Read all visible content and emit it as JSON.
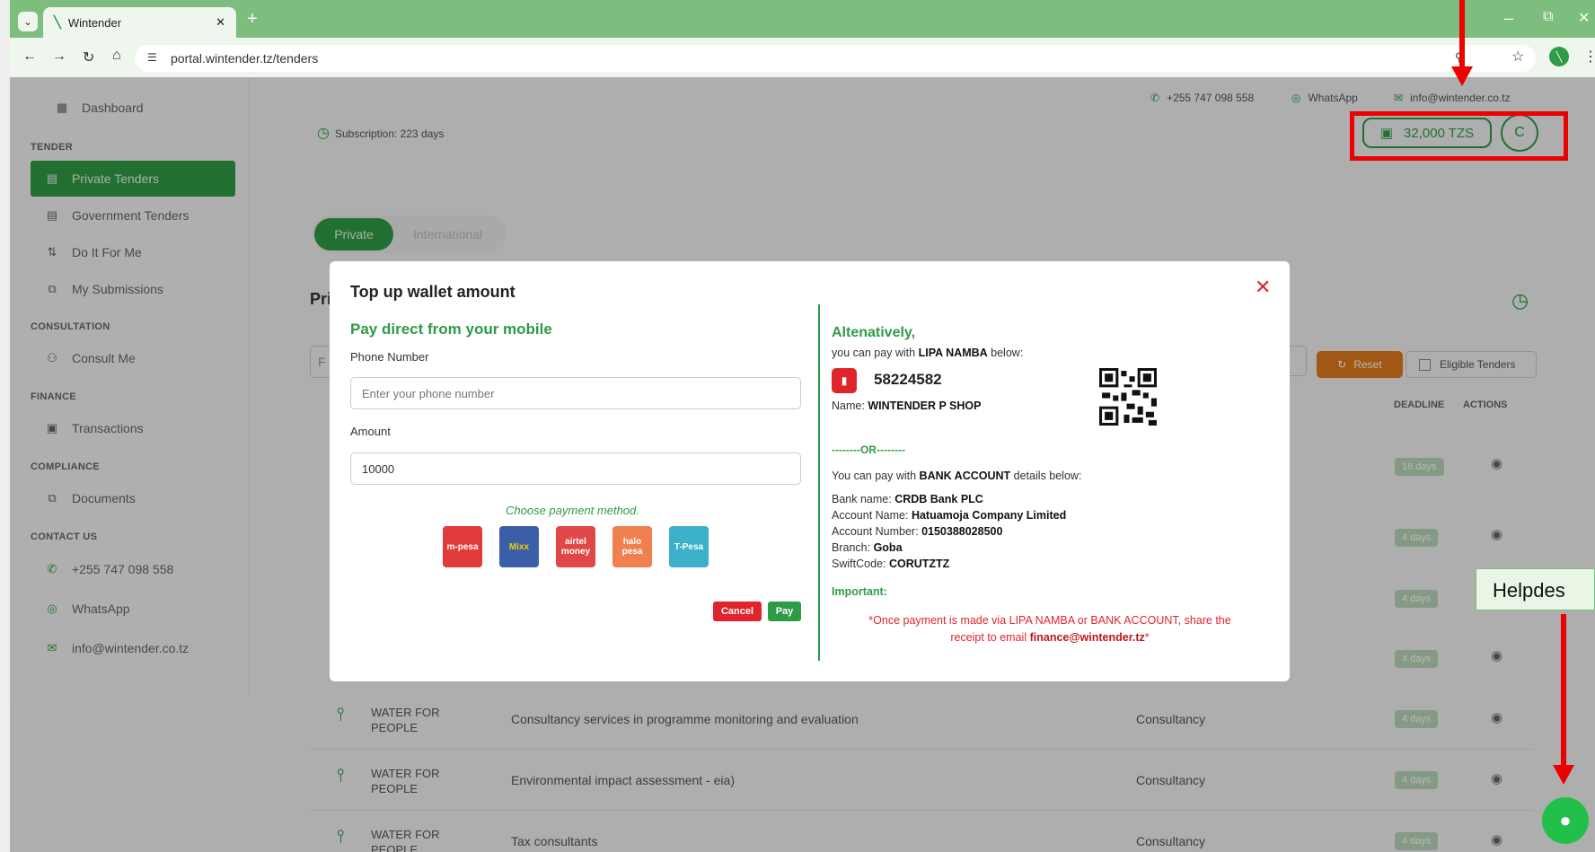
{
  "browser": {
    "tab_title": "Wintender",
    "url": "portal.wintender.tz/tenders"
  },
  "topbar": {
    "phone": "+255 747 098 558",
    "whatsapp": "WhatsApp",
    "email": "info@wintender.co.tz",
    "subscription": "Subscription: 223 days",
    "wallet": "32,000 TZS",
    "avatar": "C"
  },
  "sidebar": {
    "dashboard": "Dashboard",
    "sec_tender": "TENDER",
    "private": "Private Tenders",
    "government": "Government Tenders",
    "doit": "Do It For Me",
    "submissions": "My Submissions",
    "sec_consult": "CONSULTATION",
    "consult": "Consult Me",
    "sec_finance": "FINANCE",
    "transactions": "Transactions",
    "sec_compliance": "COMPLIANCE",
    "documents": "Documents",
    "sec_contact": "CONTACT US",
    "phone": "+255 747 098 558",
    "whatsapp": "WhatsApp",
    "email": "info@wintender.co.tz"
  },
  "main": {
    "tab_private": "Private",
    "tab_international": "International",
    "heading_fragment": "Pri",
    "filter_fragment": "F",
    "reset": "Reset",
    "eligible": "Eligible Tenders",
    "col_deadline": "DEADLINE",
    "col_actions": "ACTIONS",
    "rows": [
      {
        "org": "WATER FOR PEOPLE",
        "title": "Consultancy services in programme monitoring and evaluation",
        "category": "Consultancy",
        "deadline": "4 days"
      },
      {
        "org": "WATER FOR PEOPLE",
        "title": "Environmental impact assessment - eia)",
        "category": "Consultancy",
        "deadline": "4 days"
      },
      {
        "org": "WATER FOR PEOPLE",
        "title": "Tax consultants",
        "category": "Consultancy",
        "deadline": "4 days"
      }
    ],
    "hidden_deadlines": [
      "16 days",
      "4 days",
      "4 days",
      "4 days"
    ]
  },
  "modal": {
    "title": "Top up wallet amount",
    "left_heading": "Pay direct from your mobile",
    "phone_label": "Phone Number",
    "phone_placeholder": "Enter your phone number",
    "amount_label": "Amount",
    "amount_value": "10000",
    "choose": "Choose payment method.",
    "methods": [
      "m-pesa",
      "Mixx",
      "airtel money",
      "halo pesa",
      "T-Pesa"
    ],
    "cancel": "Cancel",
    "pay": "Pay",
    "alt_heading": "Altenatively,",
    "lipa_prefix": "you can pay with",
    "lipa_bold": "LIPA NAMBA",
    "lipa_suffix": "below:",
    "lipa_number": "58224582",
    "name_label": "Name:",
    "name_value": "WINTENDER P SHOP",
    "or": "--------OR--------",
    "bank_prefix": "You can pay with",
    "bank_bold": "BANK ACCOUNT",
    "bank_suffix": "details below:",
    "bank_name_label": "Bank name:",
    "bank_name": "CRDB Bank PLC",
    "acc_name_label": "Account Name:",
    "acc_name": "Hatuamoja Company Limited",
    "acc_no_label": "Account Number:",
    "acc_no": "0150388028500",
    "branch_label": "Branch:",
    "branch": "Goba",
    "swift_label": "SwiftCode:",
    "swift": "CORUTZTZ",
    "important": "Important:",
    "note1": "*Once payment is made via LIPA NAMBA or BANK ACCOUNT, share the",
    "note2_prefix": "receipt to email",
    "note2_email": "finance@wintender.tz",
    "note2_suffix": "*"
  },
  "helpdesk": "Helpdes",
  "colors": {
    "brand": "#2e9b45",
    "danger": "#e0242c",
    "annotation": "#ee0000"
  }
}
